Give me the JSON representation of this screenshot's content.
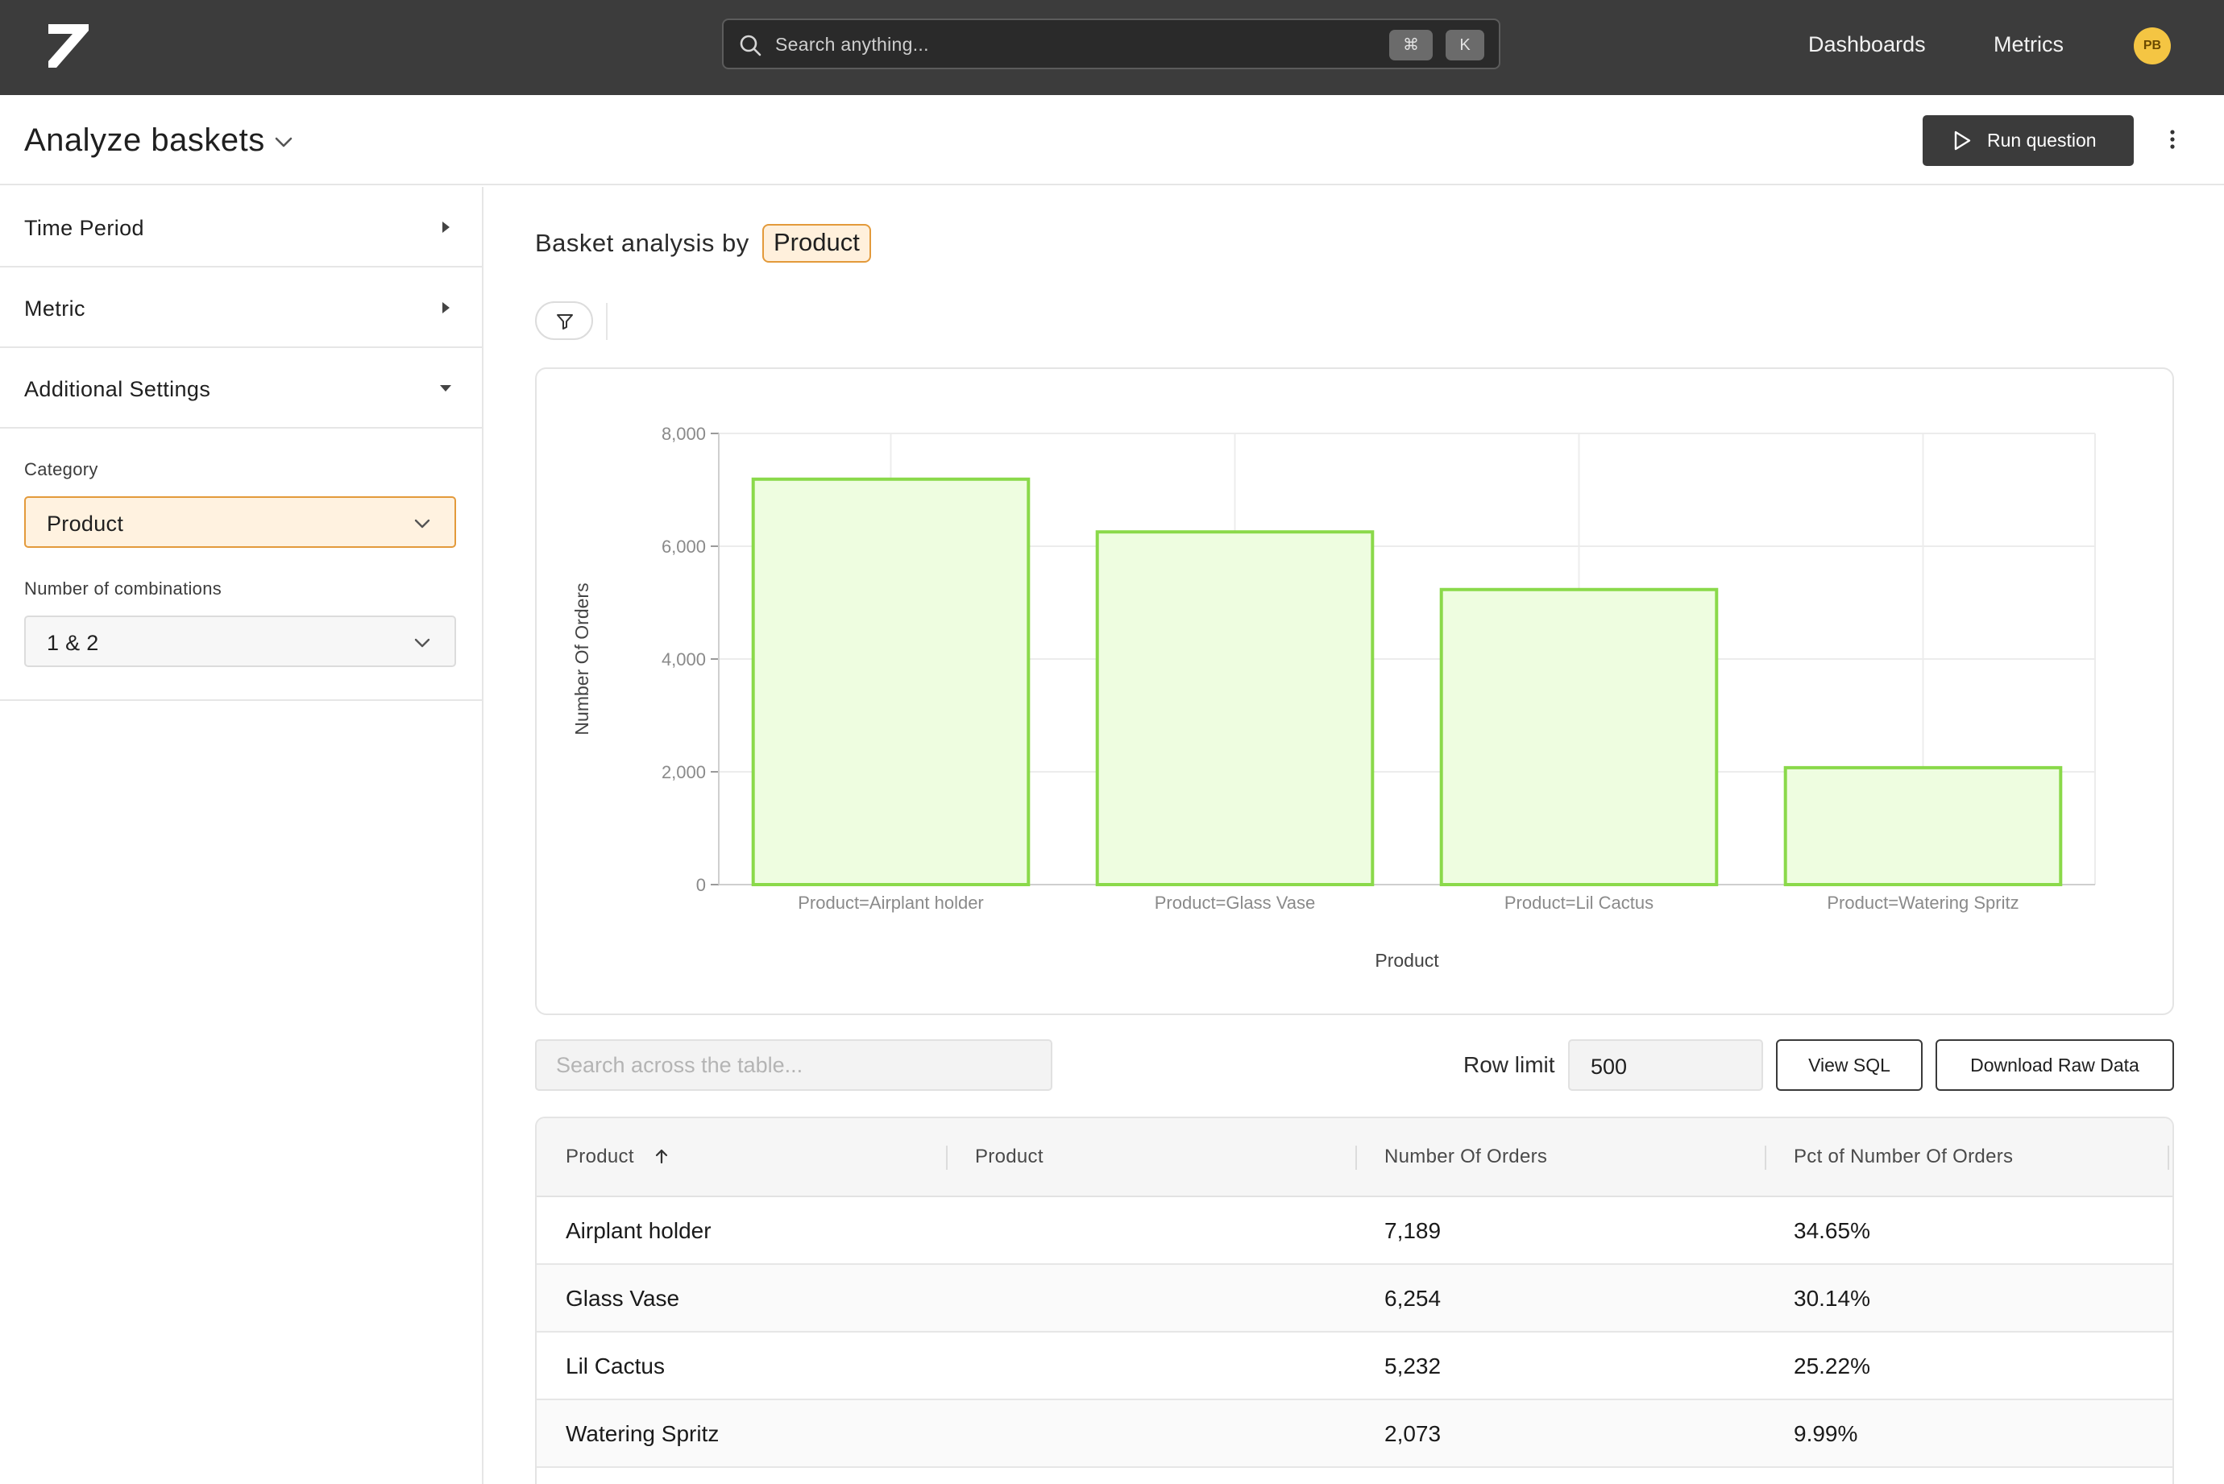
{
  "nav": {
    "search_placeholder": "Search anything...",
    "shortcut_modifier": "⌘",
    "shortcut_key": "K",
    "links": [
      "Dashboards",
      "Metrics"
    ],
    "avatar_initials": "PB"
  },
  "header": {
    "title": "Analyze baskets",
    "run_label": "Run question"
  },
  "sidebar": {
    "sections": [
      "Time Period",
      "Metric",
      "Additional Settings"
    ],
    "category_label": "Category",
    "category_value": "Product",
    "combinations_label": "Number of combinations",
    "combinations_value": "1 & 2"
  },
  "main": {
    "basket_prefix": "Basket analysis by",
    "basket_dimension": "Product",
    "table_search_placeholder": "Search across the table...",
    "row_limit_label": "Row limit",
    "row_limit_value": "500",
    "view_sql_label": "View SQL",
    "download_label": "Download Raw Data"
  },
  "chart_data": {
    "type": "bar",
    "categories": [
      "Product=Airplant holder",
      "Product=Glass Vase",
      "Product=Lil Cactus",
      "Product=Watering Spritz"
    ],
    "values": [
      7189,
      6254,
      5232,
      2073
    ],
    "xlabel": "Product",
    "ylabel": "Number Of Orders",
    "ylim": [
      0,
      8000
    ],
    "yticks": [
      0,
      2000,
      4000,
      6000,
      8000
    ],
    "ytick_labels": [
      "0",
      "2,000",
      "4,000",
      "6,000",
      "8,000"
    ],
    "grid": true,
    "bar_fill": "#eefde0",
    "bar_stroke": "#8ad94a"
  },
  "table": {
    "headers": [
      "Product",
      "Product",
      "Number Of Orders",
      "Pct of Number Of Orders"
    ],
    "rows": [
      [
        "Airplant holder",
        "",
        "7,189",
        "34.65%"
      ],
      [
        "Glass Vase",
        "",
        "6,254",
        "30.14%"
      ],
      [
        "Lil Cactus",
        "",
        "5,232",
        "25.22%"
      ],
      [
        "Watering Spritz",
        "",
        "2,073",
        "9.99%"
      ]
    ]
  }
}
